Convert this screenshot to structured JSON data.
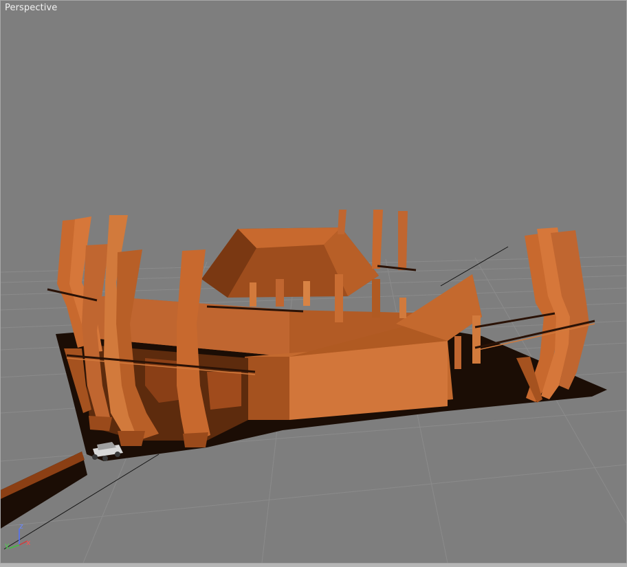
{
  "viewport": {
    "label": "Perspective"
  },
  "axes": {
    "x": "x",
    "y": "y",
    "z": "z"
  },
  "colors": {
    "background": "#7e7e7e",
    "grid": "#8a8a8a",
    "model_orange": "#c8692e",
    "model_shadow": "#1c0d05",
    "axis_x": "#d04040",
    "axis_y": "#40c040",
    "axis_z": "#6080ff"
  }
}
